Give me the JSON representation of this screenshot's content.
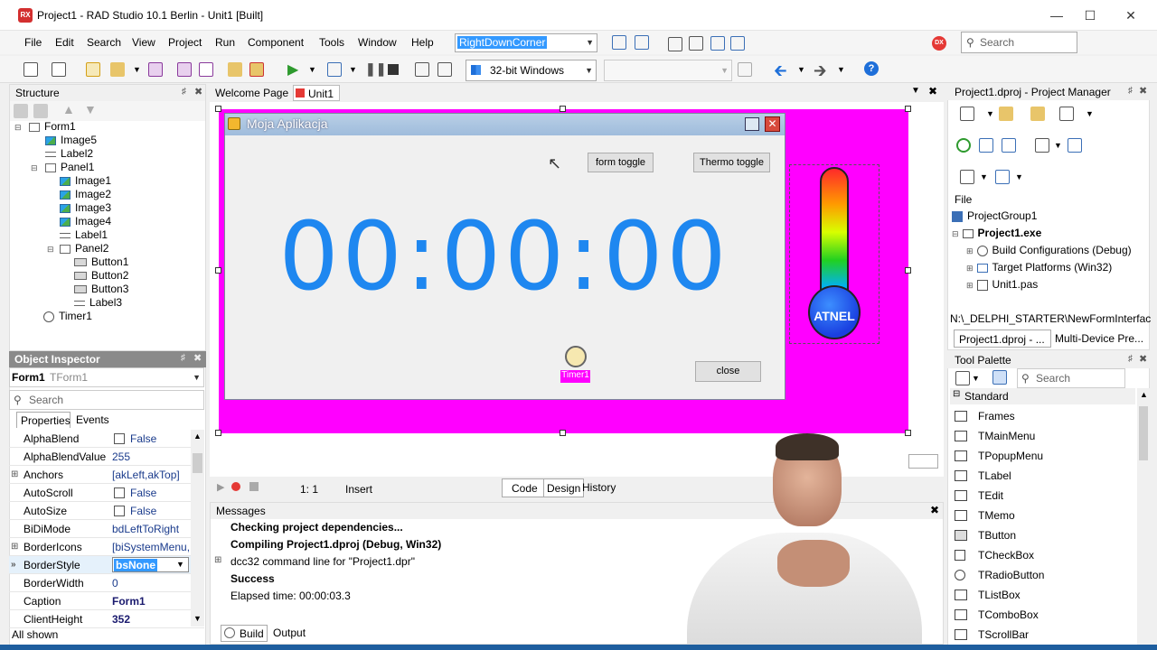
{
  "window": {
    "title": "Project1 - RAD Studio 10.1 Berlin - Unit1 [Built]",
    "app_icon": "RX"
  },
  "menu": [
    "File",
    "Edit",
    "Search",
    "View",
    "Project",
    "Run",
    "Component",
    "Tools",
    "Window",
    "Help"
  ],
  "layout_combo": "RightDownCorner",
  "ide_search_placeholder": "Search",
  "platform_combo": "32-bit Windows",
  "structure": {
    "title": "Structure",
    "items": [
      "Form1",
      "Image5",
      "Label2",
      "Panel1",
      "Image1",
      "Image2",
      "Image3",
      "Image4",
      "Label1",
      "Panel2",
      "Button1",
      "Button2",
      "Button3",
      "Label3",
      "Timer1"
    ]
  },
  "object_inspector": {
    "title": "Object Inspector",
    "selected": "Form1",
    "selected_type": "TForm1",
    "search_placeholder": "Search",
    "tabs": [
      "Properties",
      "Events"
    ],
    "rows": [
      {
        "name": "AlphaBlend",
        "value": "False"
      },
      {
        "name": "AlphaBlendValue",
        "value": "255"
      },
      {
        "name": "Anchors",
        "value": "[akLeft,akTop]"
      },
      {
        "name": "AutoScroll",
        "value": "False"
      },
      {
        "name": "AutoSize",
        "value": "False"
      },
      {
        "name": "BiDiMode",
        "value": "bdLeftToRight"
      },
      {
        "name": "BorderIcons",
        "value": "[biSystemMenu,"
      },
      {
        "name": "BorderStyle",
        "value": "bsNone"
      },
      {
        "name": "BorderWidth",
        "value": "0"
      },
      {
        "name": "Caption",
        "value": "Form1"
      },
      {
        "name": "ClientHeight",
        "value": "352"
      }
    ],
    "status": "All shown"
  },
  "editor": {
    "tabs": [
      "Welcome Page",
      "Unit1"
    ],
    "status_pos": "1:   1",
    "status_mode": "Insert",
    "view_tabs": [
      "Code",
      "Design",
      "History"
    ]
  },
  "form": {
    "caption": "Moja Aplikacja",
    "clock": "00:00:00",
    "buttons": {
      "form_toggle": "form toggle",
      "thermo_toggle": "Thermo toggle",
      "close": "close"
    },
    "timer_label": "Timer1",
    "thermo_label": "ATNEL"
  },
  "messages": {
    "title": "Messages",
    "lines": [
      "Checking project dependencies...",
      "Compiling Project1.dproj (Debug, Win32)",
      "dcc32 command line for \"Project1.dpr\"",
      "Success",
      "Elapsed time: 00:00:03.3"
    ],
    "tabs": [
      "Build",
      "Output"
    ]
  },
  "project_manager": {
    "title": "Project1.dproj - Project Manager",
    "file_label": "File",
    "items": [
      "ProjectGroup1",
      "Project1.exe",
      "Build Configurations (Debug)",
      "Target Platforms (Win32)",
      "Unit1.pas"
    ],
    "path": "N:\\_DELPHI_STARTER\\NewFormInterface\\",
    "tabs": [
      "Project1.dproj - ...",
      "Multi-Device Pre..."
    ]
  },
  "tool_palette": {
    "title": "Tool Palette",
    "search_placeholder": "Search",
    "category": "Standard",
    "items": [
      "Frames",
      "TMainMenu",
      "TPopupMenu",
      "TLabel",
      "TEdit",
      "TMemo",
      "TButton",
      "TCheckBox",
      "TRadioButton",
      "TListBox",
      "TComboBox",
      "TScrollBar"
    ]
  },
  "colors": {
    "accent_blue": "#1e87f0",
    "magenta": "#ff00ff",
    "selection": "#3399ff"
  }
}
